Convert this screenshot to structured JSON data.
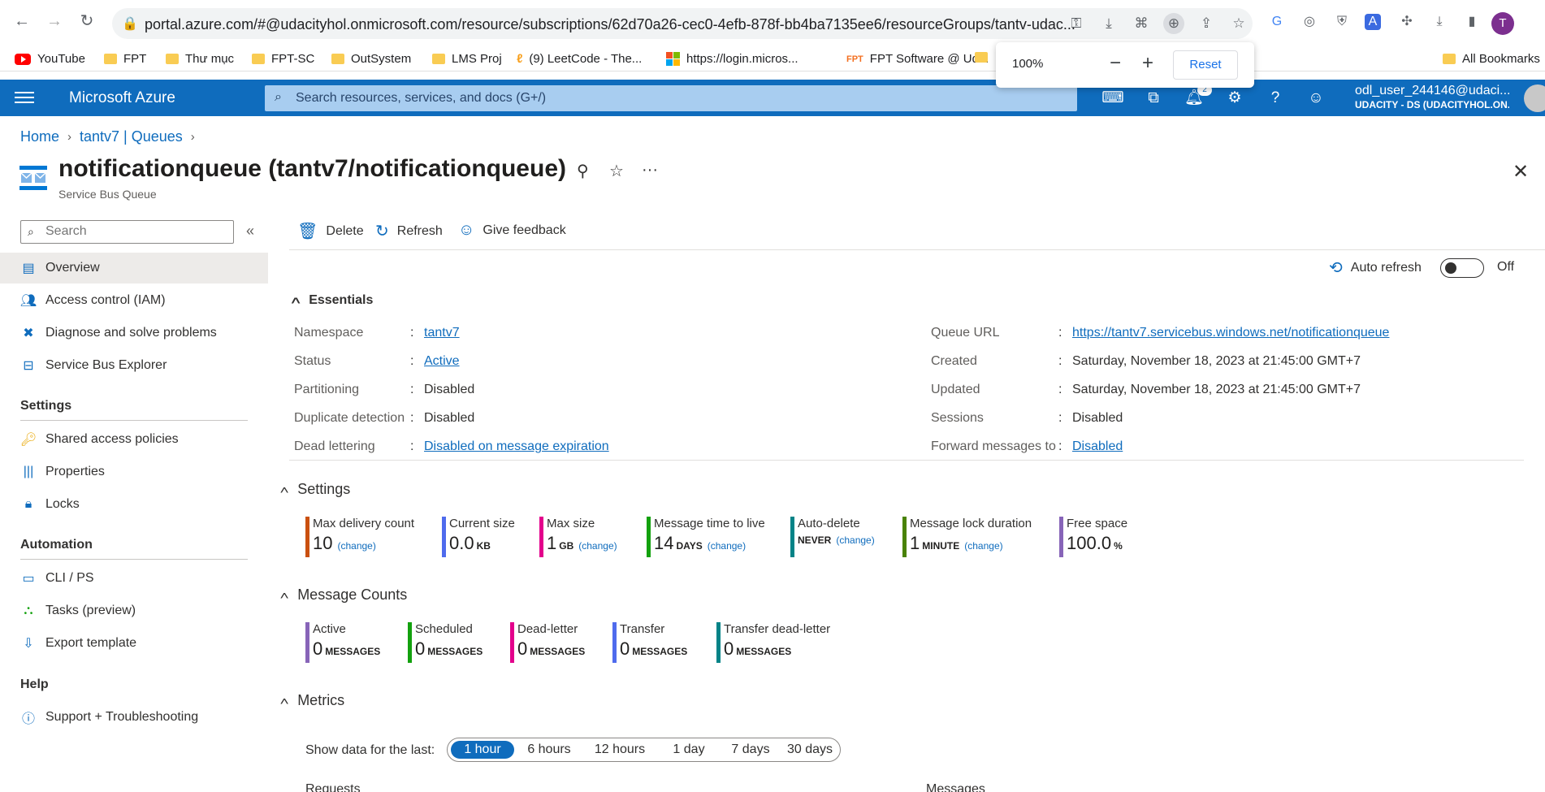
{
  "browser": {
    "url": "portal.azure.com/#@udacityhol.onmicrosoft.com/resource/subscriptions/62d70a26-cec0-4efb-878f-bb4ba7135ee6/resourceGroups/tantv-udac...",
    "profile_initial": "T",
    "zoom": {
      "value": "100%",
      "reset_label": "Reset"
    },
    "bookmarks": [
      "YouTube",
      "FPT",
      "Thư mục",
      "FPT-SC",
      "OutSystem",
      "LMS Proj",
      "(9) LeetCode - The...",
      "https://login.micros...",
      "FPT Software @ Ud..."
    ],
    "all_bookmarks": "All Bookmarks"
  },
  "azure": {
    "brand": "Microsoft Azure",
    "search_placeholder": "Search resources, services, and docs (G+/)",
    "notification_count": "2",
    "account_user": "odl_user_244146@udaci...",
    "account_tenant": "UDACITY - DS (UDACITYHOL.ON..."
  },
  "breadcrumb": {
    "home": "Home",
    "parent": "tantv7 | Queues"
  },
  "page": {
    "title": "notificationqueue (tantv7/notificationqueue)",
    "subtitle": "Service Bus Queue"
  },
  "sidebar": {
    "search_placeholder": "Search",
    "items": [
      {
        "label": "Overview",
        "icon": "overview-icon"
      },
      {
        "label": "Access control (IAM)",
        "icon": "people-icon"
      },
      {
        "label": "Diagnose and solve problems",
        "icon": "wrench-icon"
      },
      {
        "label": "Service Bus Explorer",
        "icon": "explorer-icon"
      }
    ],
    "settings_title": "Settings",
    "settings_items": [
      {
        "label": "Shared access policies",
        "icon": "key-icon"
      },
      {
        "label": "Properties",
        "icon": "properties-icon"
      },
      {
        "label": "Locks",
        "icon": "lock-icon"
      }
    ],
    "automation_title": "Automation",
    "automation_items": [
      {
        "label": "CLI / PS",
        "icon": "terminal-icon"
      },
      {
        "label": "Tasks (preview)",
        "icon": "tasks-icon"
      },
      {
        "label": "Export template",
        "icon": "export-icon"
      }
    ],
    "help_title": "Help",
    "help_items": [
      {
        "label": "Support + Troubleshooting",
        "icon": "help-circle-icon"
      }
    ]
  },
  "commands": {
    "delete": "Delete",
    "refresh": "Refresh",
    "feedback": "Give feedback"
  },
  "auto_refresh": {
    "label": "Auto refresh",
    "state": "Off"
  },
  "essentials": {
    "title": "Essentials",
    "left": [
      {
        "label": "Namespace",
        "value": "tantv7",
        "link": true
      },
      {
        "label": "Status",
        "value": "Active",
        "link": true
      },
      {
        "label": "Partitioning",
        "value": "Disabled",
        "link": false
      },
      {
        "label": "Duplicate detection",
        "value": "Disabled",
        "link": false
      },
      {
        "label": "Dead lettering",
        "value": "Disabled on message expiration",
        "link": true
      }
    ],
    "right": [
      {
        "label": "Queue URL",
        "value": "https://tantv7.servicebus.windows.net/notificationqueue",
        "link": true
      },
      {
        "label": "Created",
        "value": "Saturday, November 18, 2023 at 21:45:00 GMT+7",
        "link": false
      },
      {
        "label": "Updated",
        "value": "Saturday, November 18, 2023 at 21:45:00 GMT+7",
        "link": false
      },
      {
        "label": "Sessions",
        "value": "Disabled",
        "link": false
      },
      {
        "label": "Forward messages to",
        "value": "Disabled",
        "link": true
      }
    ]
  },
  "settings": {
    "title": "Settings",
    "tiles": [
      {
        "label": "Max delivery count",
        "value": "10",
        "unit": "",
        "change": "(change)",
        "color": "#ca5010"
      },
      {
        "label": "Current size",
        "value": "0.0",
        "unit": "KB",
        "change": "",
        "color": "#4f6bed"
      },
      {
        "label": "Max size",
        "value": "1",
        "unit": "GB",
        "change": "(change)",
        "color": "#e3008c"
      },
      {
        "label": "Message time to live",
        "value": "14",
        "unit": "DAYS",
        "change": "(change)",
        "color": "#13a10e"
      },
      {
        "label": "Auto-delete",
        "value": "",
        "unit": "NEVER",
        "change": "(change)",
        "color": "#038387"
      },
      {
        "label": "Message lock duration",
        "value": "1",
        "unit": "MINUTE",
        "change": "(change)",
        "color": "#498205"
      },
      {
        "label": "Free space",
        "value": "100.0",
        "unit": "%",
        "change": "",
        "color": "#8764b8"
      }
    ]
  },
  "message_counts": {
    "title": "Message Counts",
    "tiles": [
      {
        "label": "Active",
        "value": "0",
        "unit": "MESSAGES",
        "color": "#8764b8"
      },
      {
        "label": "Scheduled",
        "value": "0",
        "unit": "MESSAGES",
        "color": "#13a10e"
      },
      {
        "label": "Dead-letter",
        "value": "0",
        "unit": "MESSAGES",
        "color": "#e3008c"
      },
      {
        "label": "Transfer",
        "value": "0",
        "unit": "MESSAGES",
        "color": "#4f6bed"
      },
      {
        "label": "Transfer dead-letter",
        "value": "0",
        "unit": "MESSAGES",
        "color": "#038387"
      }
    ]
  },
  "metrics": {
    "title": "Metrics",
    "show_label": "Show data for the last:",
    "ranges": [
      "1 hour",
      "6 hours",
      "12 hours",
      "1 day",
      "7 days",
      "30 days"
    ],
    "selected": "1 hour",
    "charts": [
      "Requests",
      "Messages"
    ]
  }
}
